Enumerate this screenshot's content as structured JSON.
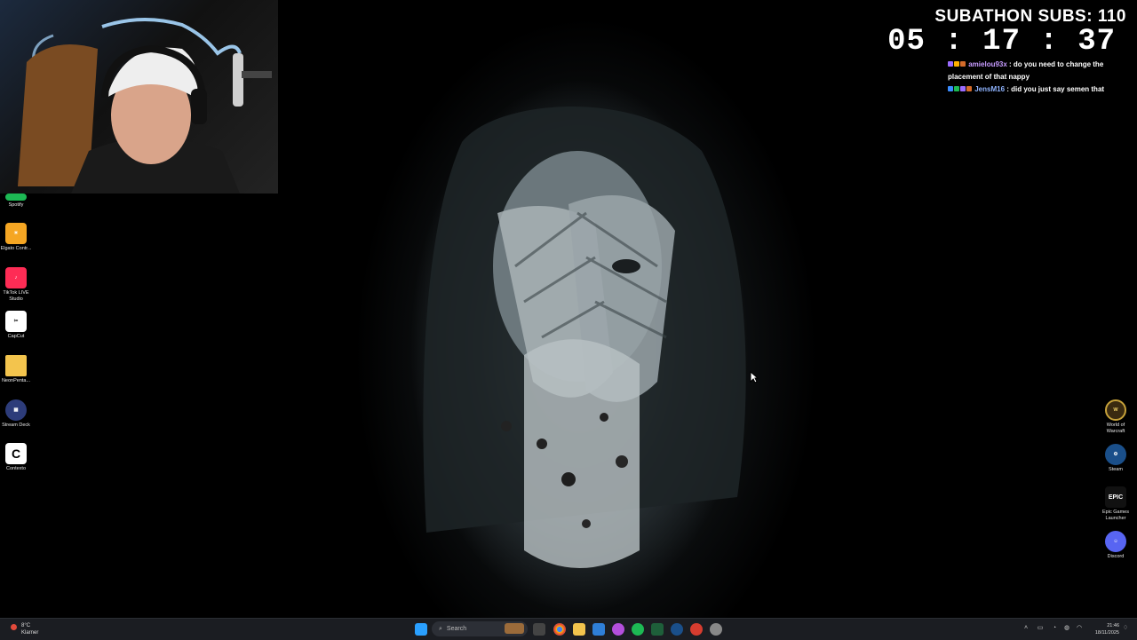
{
  "overlay": {
    "subathon_title": "SUBATHON SUBS: 110",
    "timer": "05 : 17 : 37"
  },
  "chat": {
    "messages": [
      {
        "user": "amielou93x",
        "user_color": "#c79bff",
        "text": " : do you need to change the placement of that nappy"
      },
      {
        "user": "JensM16",
        "user_color": "#8fb4ff",
        "text": " : did you just say semen that"
      }
    ]
  },
  "desktop_left": [
    {
      "label": "Spotify",
      "icon": "spotify-icon",
      "color": "#1db954"
    },
    {
      "label": "Elgato Contr...",
      "icon": "elgato-control-icon",
      "color": "#f5a623"
    },
    {
      "label": "TikTok LIVE Studio",
      "icon": "tiktok-icon",
      "color": "#fe2c55"
    },
    {
      "label": "CapCut",
      "icon": "capcut-icon",
      "color": "#ffffff"
    },
    {
      "label": "NeonPenta...",
      "icon": "folder-icon",
      "color": "#f3c44d"
    },
    {
      "label": "Stream Deck",
      "icon": "stream-deck-icon",
      "color": "#2d3c7a"
    },
    {
      "label": "Contexto",
      "icon": "contexto-icon",
      "color": "#ffffff"
    }
  ],
  "desktop_right": [
    {
      "label": "World of Warcraft",
      "icon": "world-of-warcraft-icon",
      "color": "#c7a23a"
    },
    {
      "label": "Steam",
      "icon": "steam-icon",
      "color": "#1a4f8a"
    },
    {
      "label": "Epic Games Launcher",
      "icon": "epic-games-icon",
      "color": "#111111"
    },
    {
      "label": "Discord",
      "icon": "discord-icon",
      "color": "#5865f2"
    }
  ],
  "taskbar": {
    "weather_temp": "8°C",
    "weather_desc": "Klarner",
    "search_placeholder": "Search",
    "clock_time": "21:46",
    "clock_date": "18/11/2025"
  }
}
